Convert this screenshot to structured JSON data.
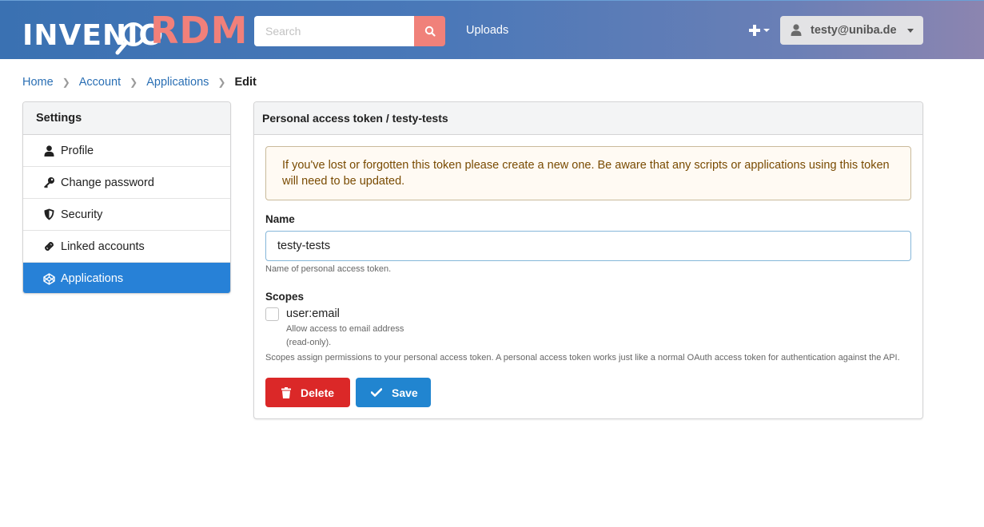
{
  "header": {
    "logo_text_left": "INVENIO",
    "logo_text_right": "RDM",
    "search_placeholder": "Search",
    "uploads_label": "Uploads",
    "user_label": "testy@uniba.de",
    "colors": {
      "brand_accent": "#f1807a",
      "header_blue": "#3a71b2"
    }
  },
  "breadcrumb": {
    "items": [
      "Home",
      "Account",
      "Applications"
    ],
    "active": "Edit"
  },
  "sidebar": {
    "title": "Settings",
    "items": [
      {
        "label": "Profile",
        "icon": "user-icon"
      },
      {
        "label": "Change password",
        "icon": "key-icon"
      },
      {
        "label": "Security",
        "icon": "shield-icon"
      },
      {
        "label": "Linked accounts",
        "icon": "link-icon"
      },
      {
        "label": "Applications",
        "icon": "codepen-icon",
        "active": true
      }
    ]
  },
  "panel": {
    "title": "Personal access token / testy-tests",
    "warning": "If you've lost or forgotten this token please create a new one. Be aware that any scripts or applications using this token will need to be updated.",
    "name_label": "Name",
    "name_value": "testy-tests",
    "name_help": "Name of personal access token.",
    "scopes_label": "Scopes",
    "scope": {
      "name": "user:email",
      "checked": false,
      "description": "Allow access to email address (read-only)."
    },
    "scopes_help": "Scopes assign permissions to your personal access token. A personal access token works just like a normal OAuth access token for authentication against the API.",
    "delete_label": "Delete",
    "save_label": "Save"
  }
}
